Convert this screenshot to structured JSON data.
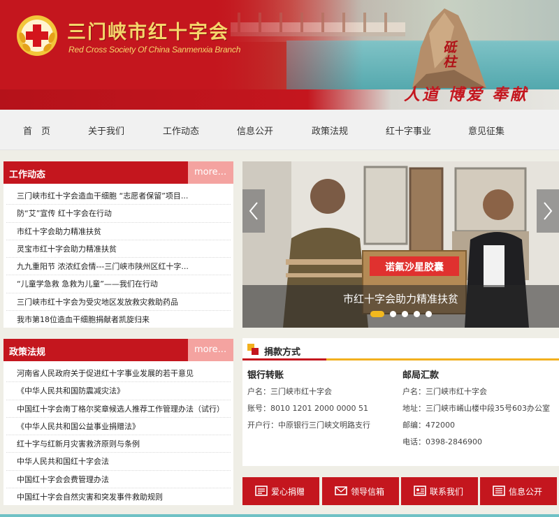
{
  "header": {
    "title": "三门峡市红十字会",
    "subtitle": "Red Cross Society Of China Sanmenxia Branch",
    "slogan": "人道 博爱 奉献",
    "rock_text": "砥柱"
  },
  "nav": {
    "items": [
      "首　页",
      "关于我们",
      "工作动态",
      "信息公开",
      "政策法规",
      "红十字事业",
      "意见征集"
    ]
  },
  "work_news": {
    "title": "工作动态",
    "more": "more...",
    "items": [
      "三门峡市红十字会造血干细胞 “志愿者保留”项目...",
      "防“艾”宣传 红十字会在行动",
      "市红十字会助力精准扶贫",
      "灵宝市红十字会助力精准扶贫",
      "九九重阳节 浓浓红会情---三门峡市陕州区红十字...",
      "“儿童学急救 急救为儿童”——我们在行动",
      "三门峡市红十字会为受灾地区发放救灾救助药品",
      "我市第18位造血干细胞捐献者凯旋归来"
    ]
  },
  "policy": {
    "title": "政策法规",
    "more": "more...",
    "items": [
      "河南省人民政府关于促进红十字事业发展的若干意见",
      "《中华人民共和国防震减灾法》",
      "中国红十字会南丁格尔奖章候选人推荐工作管理办法（试行）",
      "《中华人民共和国公益事业捐赠法》",
      "红十字与红新月灾害救济原则与条例",
      "中华人民共和国红十字会法",
      "中国红十字会会费管理办法",
      "中国红十字会自然灾害和突发事件救助规则"
    ]
  },
  "slider": {
    "caption": "市红十字会助力精准扶贫",
    "box_text": "诺氟沙星胶囊",
    "slides": 5,
    "active": 1
  },
  "donation": {
    "title": "捐款方式",
    "bank": {
      "heading": "银行转账",
      "lines": [
        "户名：三门峡市红十字会",
        "账号：8010 1201 2000 0000 51",
        "开户行：中原银行三门峡文明路支行"
      ]
    },
    "post": {
      "heading": "邮局汇款",
      "lines": [
        "户名：三门峡市红十字会",
        "地址：三门峡市崤山楼中段35号603办公室",
        "邮编：472000",
        "电话：0398-2846900"
      ]
    }
  },
  "quick_links": [
    {
      "label": "爱心捐赠",
      "icon": "donate-icon"
    },
    {
      "label": "领导信箱",
      "icon": "mail-icon"
    },
    {
      "label": "联系我们",
      "icon": "contact-icon"
    },
    {
      "label": "信息公开",
      "icon": "info-icon"
    }
  ],
  "colors": {
    "brand_red": "#c4161e",
    "more_pink": "#f4a3a0",
    "accent_yellow": "#f2b01e",
    "title_gold": "#f5d66b"
  }
}
